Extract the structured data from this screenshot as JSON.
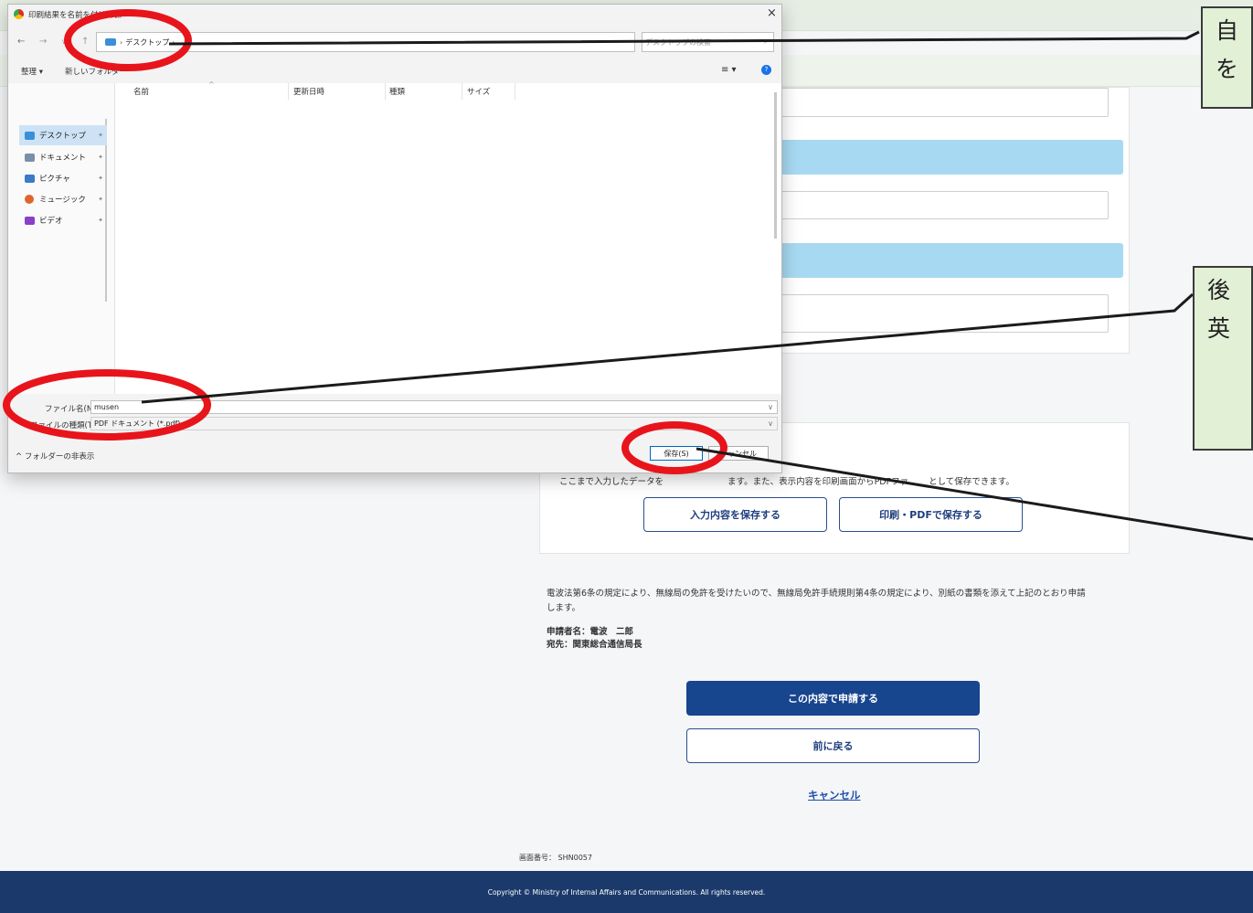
{
  "background": {
    "intro_text": "ここまで入力したデータを",
    "intro_text_2": "ます。また、表示内容を印刷画面からPDFファ",
    "intro_text_3": "として保存できます。",
    "save_input_button": "入力内容を保存する",
    "print_pdf_button": "印刷・PDFで保存する",
    "declaration": "電波法第6条の規定により、無線局の免許を受けたいので、無線局免許手続規則第4条の規定により、別紙の書類を添えて上記のとおり申請",
    "declaration_2": "します。",
    "applicant": "申請者名：電波　二郎",
    "destination": "宛先：関東総合通信局長",
    "submit_button": "この内容で申請する",
    "back_button": "前に戻る",
    "cancel_link": "キャンセル",
    "screen_number": "画面番号： SHN0057",
    "copyright": "Copyright © Ministry of Internal Affairs and Communications. All rights reserved."
  },
  "dialog": {
    "title": "印刷結果を名前を付けて保",
    "breadcrumb": "デスクトップ",
    "search_placeholder": "デスクトップの検索",
    "organize": "整理 ▾",
    "new_folder": "新しいフォルダー",
    "columns": [
      "名前",
      "更新日時",
      "種類",
      "サイズ"
    ],
    "sidebar_items": [
      {
        "label": "デスクトップ",
        "icon": "desktop-icon",
        "color": "#3a8fd8"
      },
      {
        "label": "ドキュメント",
        "icon": "document-icon",
        "color": "#7a8fa8"
      },
      {
        "label": "ピクチャ",
        "icon": "picture-icon",
        "color": "#3a7bc8"
      },
      {
        "label": "ミュージック",
        "icon": "music-icon",
        "color": "#e0642e"
      },
      {
        "label": "ビデオ",
        "icon": "video-icon",
        "color": "#8a3fc8"
      }
    ],
    "filename_label": "ファイル名(N):",
    "filename_value": "musen",
    "filetype_label": "ファイルの種類(T):",
    "filetype_value": "PDF ドキュメント (*.pdf)",
    "hide_folders": "^ フォルダーの非表示",
    "save_button": "保存(S)",
    "cancel_button": "キャンセル"
  },
  "annotations": {
    "callout1": "自\nを",
    "callout2": "後\n英",
    "accent_red": "#e8141c",
    "callout_bg": "#e2f0d6"
  }
}
